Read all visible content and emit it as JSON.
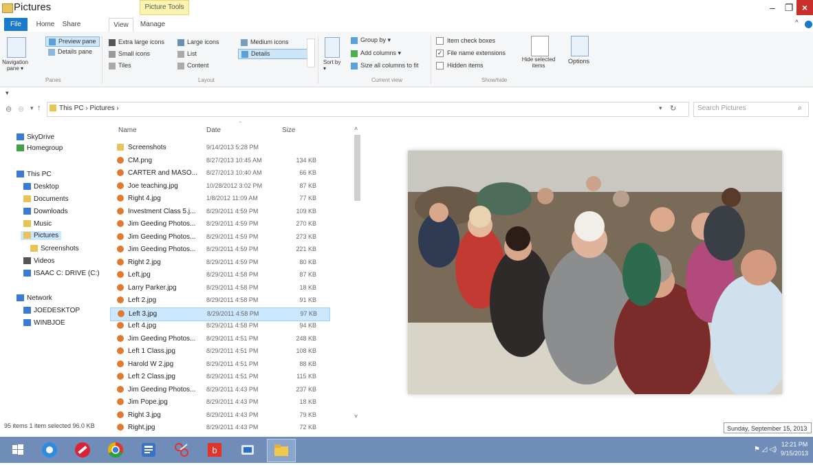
{
  "window": {
    "title": "Pictures",
    "context_tab": "Picture Tools",
    "minimize": "–",
    "maximize": "❐",
    "close": "×"
  },
  "tabs": [
    "File",
    "Home",
    "Share",
    "View",
    "Manage"
  ],
  "ribbon": {
    "panes": {
      "navigation_pane": "Navigation pane ▾",
      "preview_pane": "Preview pane",
      "details_pane": "Details pane",
      "group_label": "Panes"
    },
    "layout": {
      "items": [
        "Extra large icons",
        "Large icons",
        "Medium icons",
        "Small icons",
        "List",
        "Details",
        "Tiles",
        "Content"
      ],
      "group_label": "Layout"
    },
    "current_view": {
      "sort_by": "Sort by ▾",
      "group_by": "Group by ▾",
      "add_columns": "Add columns ▾",
      "size_all": "Size all columns to fit",
      "group_label": "Current view"
    },
    "show_hide": {
      "item_check_boxes": "Item check boxes",
      "file_name_extensions": "File name extensions",
      "hidden_items": "Hidden items",
      "hide_selected": "Hide selected items",
      "group_label": "Show/hide"
    },
    "options": "Options"
  },
  "address": {
    "path": "This PC  ›  Pictures  ›",
    "search_placeholder": "Search Pictures"
  },
  "nav_pane": [
    "SkyDrive",
    "Homegroup",
    "This PC",
    "Desktop",
    "Documents",
    "Downloads",
    "Music",
    "Pictures",
    "Screenshots",
    "Videos",
    "ISAAC C: DRIVE (C:)",
    "Network",
    "JOEDESKTOP",
    "WINBJOE"
  ],
  "columns": {
    "name": "Name",
    "date": "Date",
    "size": "Size"
  },
  "files": [
    {
      "name": "Screenshots",
      "date": "9/14/2013 5:28 PM",
      "size": ""
    },
    {
      "name": "CM.png",
      "date": "8/27/2013 10:45 AM",
      "size": "134 KB"
    },
    {
      "name": "CARTER and MASO...",
      "date": "8/27/2013 10:40 AM",
      "size": "66 KB"
    },
    {
      "name": "Joe teaching.jpg",
      "date": "10/28/2012 3:02 PM",
      "size": "87 KB"
    },
    {
      "name": "Right 4.jpg",
      "date": "1/8/2012 11:09 AM",
      "size": "77 KB"
    },
    {
      "name": "Investment Class 5.j...",
      "date": "8/29/2011 4:59 PM",
      "size": "109 KB"
    },
    {
      "name": "Jim Geeding Photos...",
      "date": "8/29/2011 4:59 PM",
      "size": "270 KB"
    },
    {
      "name": "Jim Geeding Photos...",
      "date": "8/29/2011 4:59 PM",
      "size": "273 KB"
    },
    {
      "name": "Jim Geeding Photos...",
      "date": "8/29/2011 4:59 PM",
      "size": "221 KB"
    },
    {
      "name": "Right 2.jpg",
      "date": "8/29/2011 4:59 PM",
      "size": "80 KB"
    },
    {
      "name": "Left.jpg",
      "date": "8/29/2011 4:58 PM",
      "size": "87 KB"
    },
    {
      "name": "Larry Parker.jpg",
      "date": "8/29/2011 4:58 PM",
      "size": "18 KB"
    },
    {
      "name": "Left 2.jpg",
      "date": "8/29/2011 4:58 PM",
      "size": "91 KB"
    },
    {
      "name": "Left 3.jpg",
      "date": "8/29/2011 4:58 PM",
      "size": "97 KB"
    },
    {
      "name": "Left 4.jpg",
      "date": "8/29/2011 4:58 PM",
      "size": "94 KB"
    },
    {
      "name": "Jim Geeding Photos...",
      "date": "8/29/2011 4:51 PM",
      "size": "248 KB"
    },
    {
      "name": "Left 1 Class.jpg",
      "date": "8/29/2011 4:51 PM",
      "size": "108 KB"
    },
    {
      "name": "Harold W 2.jpg",
      "date": "8/29/2011 4:51 PM",
      "size": "88 KB"
    },
    {
      "name": "Left 2 Class.jpg",
      "date": "8/29/2011 4:51 PM",
      "size": "115 KB"
    },
    {
      "name": "Jim Geeding Photos...",
      "date": "8/29/2011 4:43 PM",
      "size": "237 KB"
    },
    {
      "name": "Jim Pope.jpg",
      "date": "8/29/2011 4:43 PM",
      "size": "18 KB"
    },
    {
      "name": "Right 3.jpg",
      "date": "8/29/2011 4:43 PM",
      "size": "79 KB"
    },
    {
      "name": "Right.jpg",
      "date": "8/29/2011 4:43 PM",
      "size": "72 KB"
    }
  ],
  "selected_file": "Left 3.jpg",
  "status": "95 items    1 item selected  96.0 KB",
  "tooltip_date": "Sunday, September 15, 2013",
  "clock": {
    "time": "12:21 PM",
    "date": "9/15/2013"
  },
  "colors": {
    "accent": "#1979ca",
    "taskbar": "#6f8db8",
    "selection": "#cce8ff",
    "close": "#c9302c"
  }
}
